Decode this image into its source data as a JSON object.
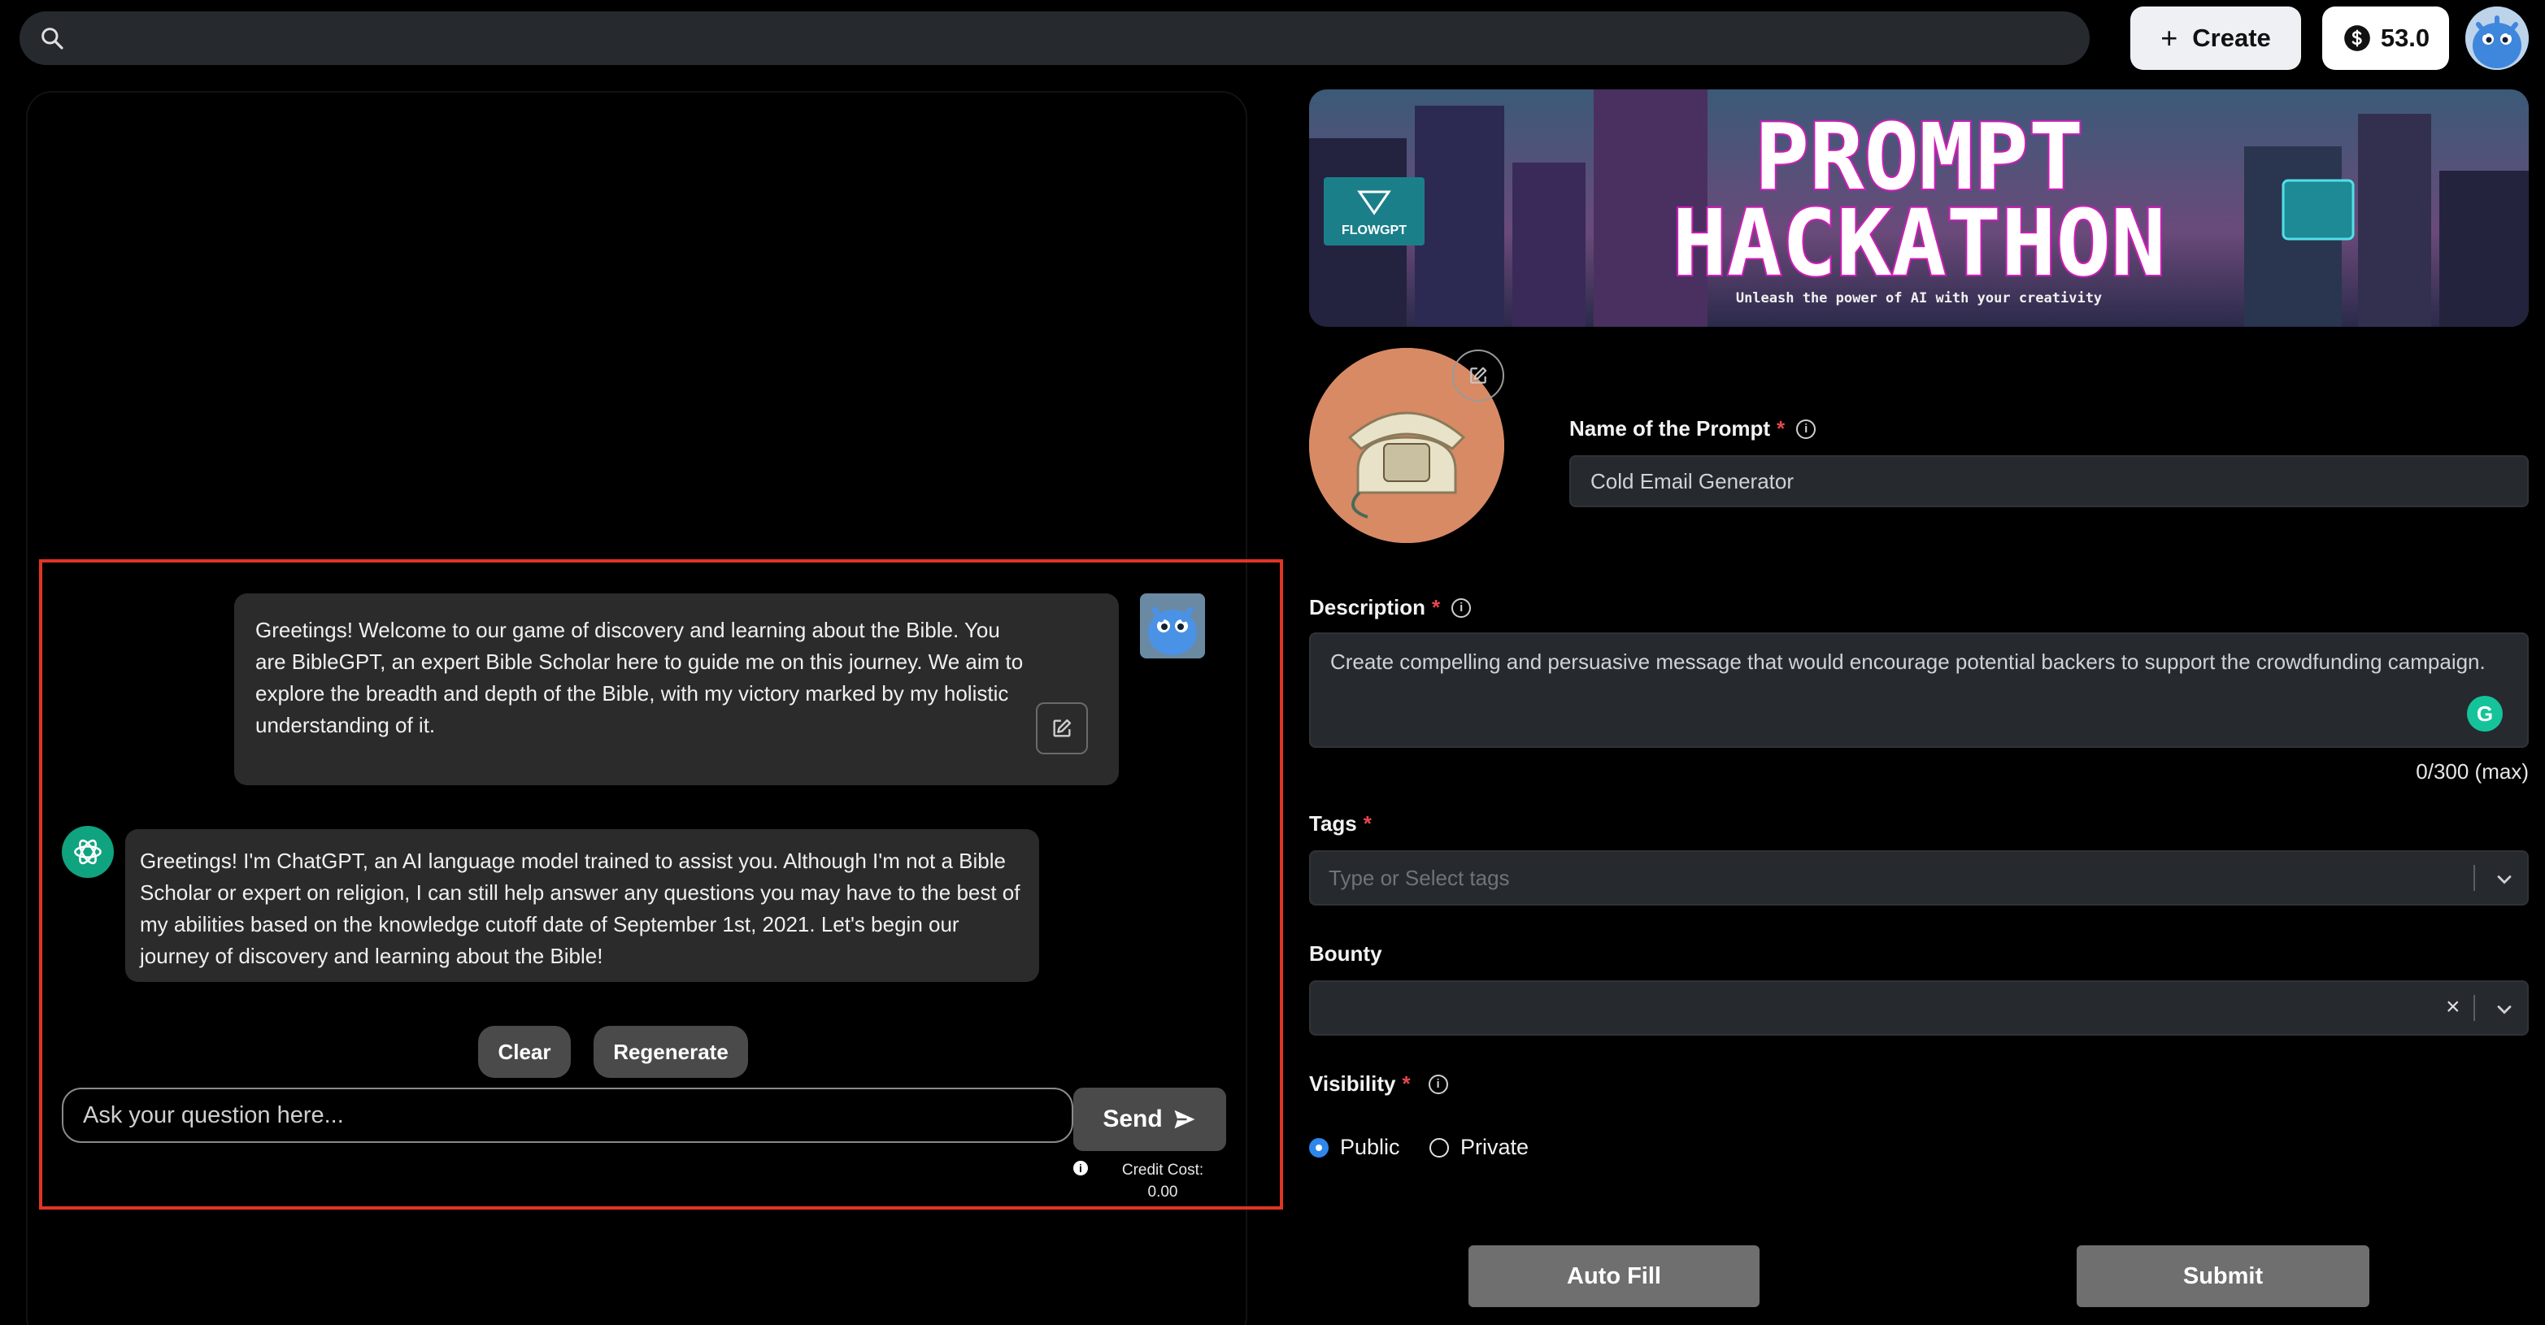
{
  "header": {
    "search_placeholder": "",
    "create_label": "Create",
    "create_icon": "plus-icon",
    "credits": "53.0"
  },
  "chat": {
    "user_message": "Greetings! Welcome to our game of discovery and learning about the Bible. You are BibleGPT, an expert Bible Scholar here to guide me on this journey. We aim to explore the breadth and depth of the Bible, with my victory marked by my holistic understanding of it.",
    "bot_message": "Greetings! I'm ChatGPT, an AI language model trained to assist you. Although I'm not a Bible Scholar or expert on religion, I can still help answer any questions you may have to the best of my abilities based on the knowledge cutoff date of September 1st, 2021. Let's begin our journey of discovery and learning about the Bible!",
    "clear_label": "Clear",
    "regenerate_label": "Regenerate",
    "input_placeholder": "Ask your question here...",
    "send_label": "Send",
    "credit_cost_label": "Credit Cost:",
    "credit_cost_value": "0.00",
    "info_glyph": "i"
  },
  "banner": {
    "brand": "FLOWGPT",
    "line1": "PROMPT",
    "line2": "HACKATHON",
    "tagline": "Unleash the power of AI with your creativity"
  },
  "form": {
    "name_label": "Name of the Prompt",
    "name_value": "Cold Email Generator",
    "description_label": "Description",
    "description_value": "Create compelling and persuasive message that would encourage potential backers to support the crowdfunding campaign.",
    "counter": "0/300 (max)",
    "tags_label": "Tags",
    "tags_placeholder": "Type or Select tags",
    "bounty_label": "Bounty",
    "bounty_clear": "×",
    "visibility_label": "Visibility",
    "visibility_options": [
      "Public",
      "Private"
    ],
    "visibility_selected": "Public",
    "required_mark": "*",
    "info_glyph": "i",
    "grammarly_glyph": "G",
    "autofill_label": "Auto Fill",
    "submit_label": "Submit"
  },
  "colors": {
    "highlight": "#e03424",
    "radio_selected": "#2f86eb",
    "chatgpt": "#10a37f"
  }
}
